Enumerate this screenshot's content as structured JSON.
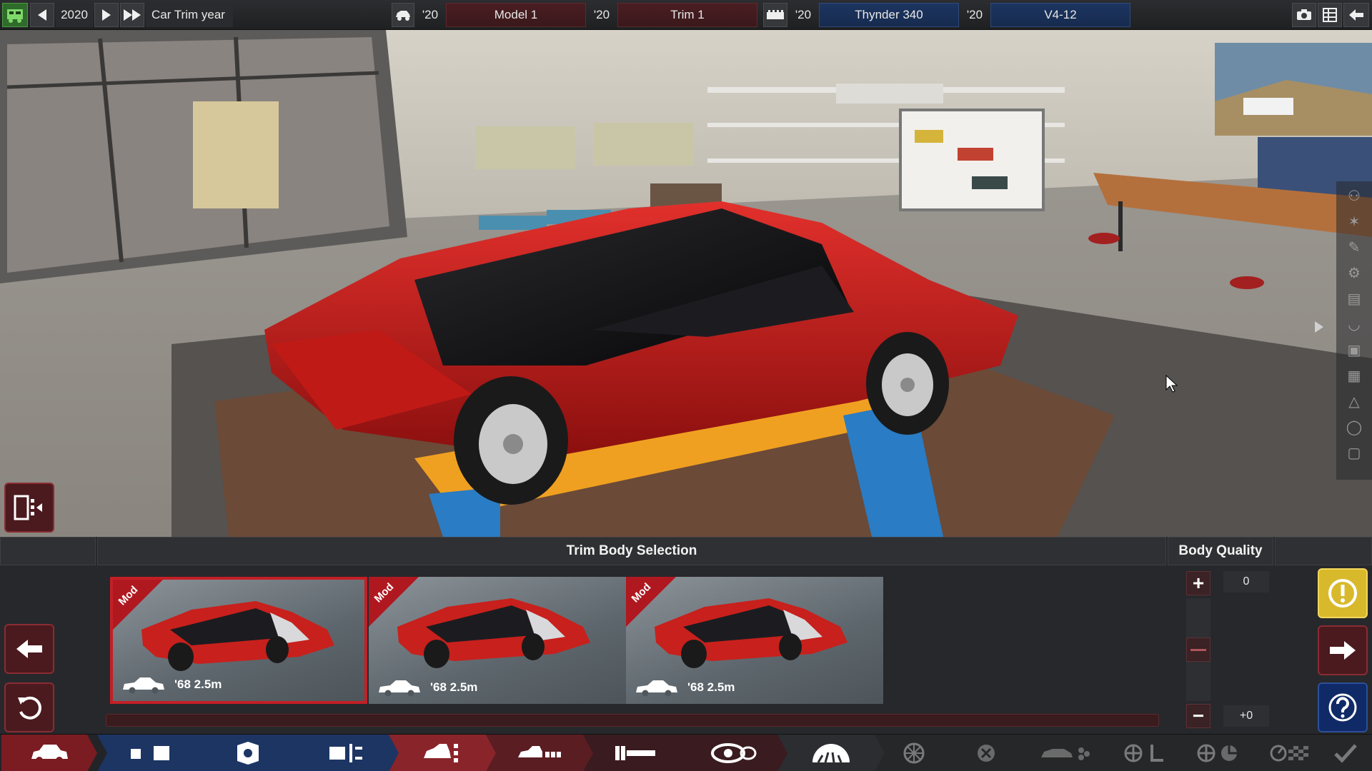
{
  "topbar": {
    "year": "2020",
    "mode_label": "Car Trim year",
    "model_year": "'20",
    "model_name": "Model 1",
    "trim_year": "'20",
    "trim_name": "Trim 1",
    "engine_family_year": "'20",
    "engine_family": "Thynder 340",
    "engine_variant_year": "'20",
    "engine_variant": "V4-12",
    "icons": [
      "app-logo-icon",
      "prev-icon",
      "play-icon",
      "fast-forward-icon",
      "car-icon",
      "engine-block-icon",
      "camera-icon",
      "spreadsheet-icon",
      "back-icon"
    ]
  },
  "panel": {
    "title": "Trim Body Selection",
    "quality_title": "Body Quality",
    "quality_value": "0",
    "quality_delta": "+0",
    "quality_level": 0.5,
    "bodies": [
      {
        "badge": "Mod",
        "info": "'68 2.5m",
        "selected": true
      },
      {
        "badge": "Mod",
        "info": "'68 2.5m",
        "selected": false
      },
      {
        "badge": "Mod",
        "info": "'68 2.5m",
        "selected": false
      }
    ]
  },
  "nav": {
    "items": [
      "car-body-icon",
      "fixtures-icon",
      "engine-blocks-icon",
      "engine-tuning-icon",
      "trim-body-icon",
      "trim-chassis-icon",
      "trim-suspension-icon",
      "trim-drivetrain-icon",
      "trim-tyres-icon",
      "trim-brakes-icon",
      "trim-aero-icon",
      "trim-interior-icon",
      "trim-safety-icon",
      "trim-test-icon",
      "trim-finish-icon",
      "trim-done-icon"
    ]
  },
  "colors": {
    "accent_red": "#c41f26",
    "accent_blue": "#1c3560",
    "warning_yellow": "#d9b92c"
  }
}
